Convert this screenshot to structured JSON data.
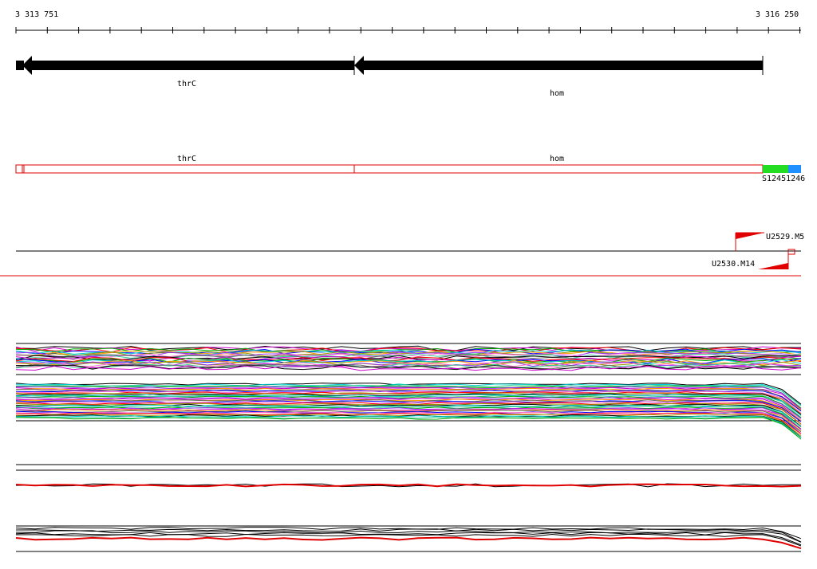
{
  "ruler": {
    "start_label": "3 313 751",
    "end_label": "3 316 250",
    "start": 3313751,
    "end": 3316250
  },
  "genes": [
    {
      "name": "thrC",
      "strand": "minus"
    },
    {
      "name": "hom",
      "strand": "minus"
    }
  ],
  "segments": {
    "thrC_label": "thrC",
    "hom_label": "hom",
    "s_label": "S1245",
    "s2_label": "1246",
    "colors": {
      "outline": "#dd0000",
      "green": "#22dd22",
      "blue": "#1e90ff"
    }
  },
  "probes": [
    {
      "label": "U2529.M5",
      "direction": "up"
    },
    {
      "label": "U2530.M14",
      "direction": "down"
    }
  ],
  "tracks": {
    "multi_a_colors": [
      "#000000",
      "#cc00cc",
      "#ff0000",
      "#00aa00",
      "#0000ff",
      "#00cccc",
      "#ff9900",
      "#999900",
      "#9933ff",
      "#ff66cc",
      "#33cc99",
      "#666666"
    ],
    "red": "#e00000"
  }
}
